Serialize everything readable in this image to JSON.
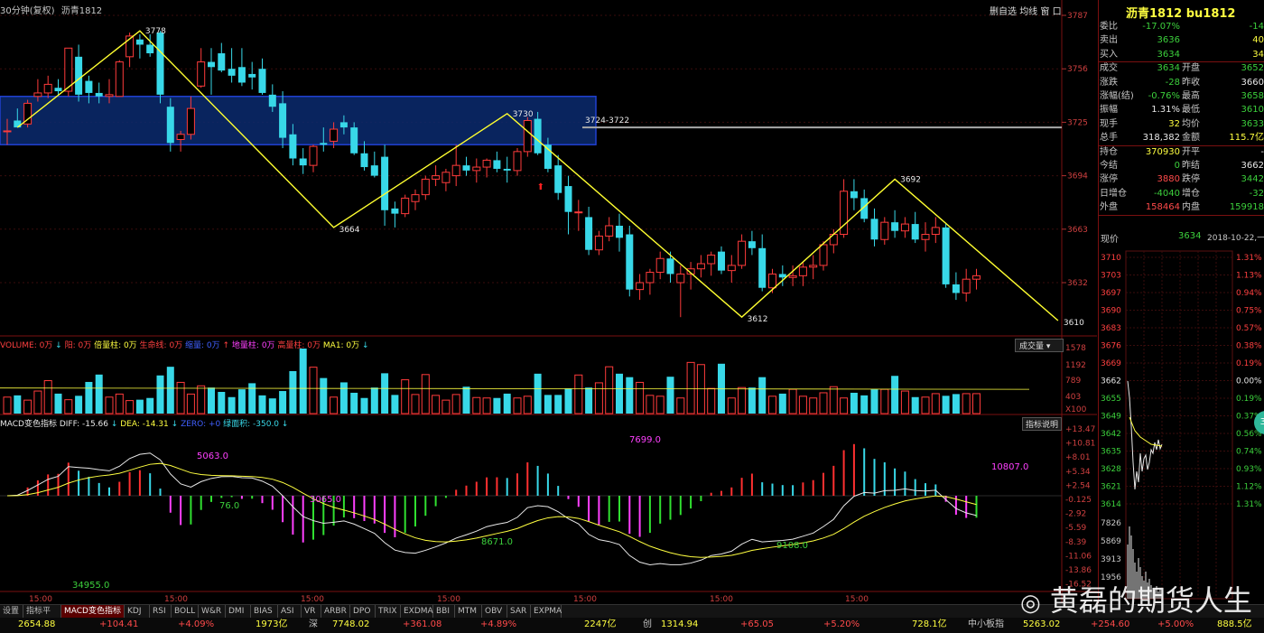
{
  "header": {
    "period": "30分钟(复权)",
    "name": "沥青1812",
    "tools": [
      "删自选",
      "均线",
      "窗",
      "口"
    ]
  },
  "price_axis": {
    "labels": [
      "3787",
      "3756",
      "3725",
      "3694",
      "3663",
      "3632"
    ],
    "values": [
      3787,
      3756,
      3725,
      3694,
      3663,
      3632
    ]
  },
  "annotations": {
    "high1": "3778",
    "low1": "3664",
    "high2": "3730",
    "zone": "3724-3722",
    "low2": "3612",
    "high3": "3692",
    "low3": "3610"
  },
  "volume_panel": {
    "legend": [
      {
        "text": "VOLUME: 0万",
        "color": "#ff4040"
      },
      {
        "text": "↓",
        "color": "#38d8e8"
      },
      {
        "text": "阳: 0万",
        "color": "#ff4040"
      },
      {
        "text": "倍量柱: 0万",
        "color": "#ffff40"
      },
      {
        "text": "生命线: 0万",
        "color": "#ff4040"
      },
      {
        "text": "缩量: 0万",
        "color": "#4060ff"
      },
      {
        "text": "↑",
        "color": "#ff4040"
      },
      {
        "text": "地量柱: 0万",
        "color": "#ff40ff"
      },
      {
        "text": "高量柱: 0万",
        "color": "#ff4040"
      },
      {
        "text": "MA1: 0万",
        "color": "#ffff40"
      },
      {
        "text": "↓",
        "color": "#38d8e8"
      }
    ],
    "dropdown": "成交量",
    "axis": [
      "1578",
      "1192",
      "789",
      "403",
      "X100"
    ]
  },
  "macd_panel": {
    "legend": [
      {
        "text": "MACD变色指标",
        "color": "#e8e8e8"
      },
      {
        "text": "DIFF: -15.66",
        "color": "#e8e8e8"
      },
      {
        "text": "↓",
        "color": "#38d8e8"
      },
      {
        "text": "DEA: -14.31",
        "color": "#ffff40"
      },
      {
        "text": "↓",
        "color": "#38d8e8"
      },
      {
        "text": "ZERO: +0",
        "color": "#4060ff"
      },
      {
        "text": "绿面积: -350.0",
        "color": "#38d8e8"
      },
      {
        "text": "↓",
        "color": "#38d8e8"
      }
    ],
    "help": "指标说明",
    "axis": [
      "+13.47",
      "+10.81",
      "+8.01",
      "+5.34",
      "+2.54",
      "-0.125",
      "-2.92",
      "-5.59",
      "-8.39",
      "-11.06",
      "-13.86",
      "-16.52"
    ],
    "area_labels": [
      {
        "text": "5063.0",
        "color": "#ff40ff"
      },
      {
        "text": "3065.0",
        "color": "#ff40ff"
      },
      {
        "text": "7699.0",
        "color": "#ff40ff"
      },
      {
        "text": "10807.0",
        "color": "#ff40ff"
      },
      {
        "text": "76.0",
        "color": "#3cd03c"
      },
      {
        "text": "8671.0",
        "color": "#3cd03c"
      },
      {
        "text": "9108.0",
        "color": "#3cd03c"
      },
      {
        "text": "34955.0",
        "color": "#3cd03c"
      }
    ]
  },
  "time_axis": [
    "15:00",
    "15:00",
    "15:00",
    "15:00",
    "15:00",
    "15:00",
    "15:00"
  ],
  "quote": {
    "title": "沥青1812 bu1812",
    "rows": [
      {
        "l1": "委比",
        "v1": "-17.07%",
        "c1": "green",
        "l2": "",
        "v2": "-14",
        "c2": "green"
      },
      {
        "l1": "卖出",
        "v1": "3636",
        "c1": "green",
        "l2": "",
        "v2": "40",
        "c2": "yellow"
      },
      {
        "l1": "买入",
        "v1": "3634",
        "c1": "green",
        "l2": "",
        "v2": "34",
        "c2": "yellow"
      },
      {
        "l1": "成交",
        "v1": "3634",
        "c1": "green",
        "l2": "开盘",
        "v2": "3652",
        "c2": "green"
      },
      {
        "l1": "涨跌",
        "v1": "-28",
        "c1": "green",
        "l2": "昨收",
        "v2": "3660",
        "c2": "white"
      },
      {
        "l1": "涨幅(结)",
        "v1": "-0.76%",
        "c1": "green",
        "l2": "最高",
        "v2": "3658",
        "c2": "green"
      },
      {
        "l1": "振幅",
        "v1": "1.31%",
        "c1": "white",
        "l2": "最低",
        "v2": "3610",
        "c2": "green"
      },
      {
        "l1": "现手",
        "v1": "32",
        "c1": "yellow",
        "l2": "均价",
        "v2": "3633",
        "c2": "green"
      },
      {
        "l1": "总手",
        "v1": "318,382",
        "c1": "white",
        "l2": "金额",
        "v2": "115.7亿",
        "c2": "yellow"
      },
      {
        "l1": "持仓",
        "v1": "370930",
        "c1": "yellow",
        "l2": "开平",
        "v2": "-",
        "c2": "white"
      },
      {
        "l1": "今结",
        "v1": "0",
        "c1": "green",
        "l2": "昨结",
        "v2": "3662",
        "c2": "white"
      },
      {
        "l1": "涨停",
        "v1": "3880",
        "c1": "red",
        "l2": "跌停",
        "v2": "3442",
        "c2": "green"
      },
      {
        "l1": "日增仓",
        "v1": "-4040",
        "c1": "green",
        "l2": "增仓",
        "v2": "-32",
        "c2": "green"
      },
      {
        "l1": "外盘",
        "v1": "158464",
        "c1": "red",
        "l2": "内盘",
        "v2": "159918",
        "c2": "green"
      }
    ],
    "now_label": "现价",
    "now_value": "3634",
    "date": "2018-10-22,一",
    "mini_left": [
      "3710",
      "3703",
      "3697",
      "3690",
      "3683",
      "3676",
      "3669",
      "3662",
      "3655",
      "3649",
      "3642",
      "3635",
      "3628",
      "3621",
      "3614",
      "7826",
      "5869",
      "3913",
      "1956"
    ],
    "mini_right": [
      "1.31%",
      "1.13%",
      "0.94%",
      "0.75%",
      "0.57%",
      "0.38%",
      "0.19%",
      "0.00%",
      "0.19%",
      "0.37%",
      "0.56%",
      "0.74%",
      "0.93%",
      "1.12%",
      "1.31%"
    ],
    "badge": "36"
  },
  "tabs": [
    "设置",
    "指标平台",
    "MACD变色指标",
    "KDJ",
    "RSI",
    "BOLL",
    "W&R",
    "DMI",
    "BIAS",
    "ASI",
    "VR",
    "ARBR",
    "DPO",
    "TRIX",
    "EXDMA",
    "BBI",
    "MTM",
    "OBV",
    "SAR",
    "EXPMA"
  ],
  "status": [
    {
      "text": "2654.88",
      "color": "#ffff40"
    },
    {
      "text": "+104.41",
      "color": "#ff4a4a"
    },
    {
      "text": "+4.09%",
      "color": "#ff4a4a"
    },
    {
      "text": "1973亿",
      "color": "#ffff40"
    },
    {
      "text": "深",
      "color": "#c8c8c8"
    },
    {
      "text": "7748.02",
      "color": "#ffff40"
    },
    {
      "text": "+361.08",
      "color": "#ff4a4a"
    },
    {
      "text": "+4.89%",
      "color": "#ff4a4a"
    },
    {
      "text": "2247亿",
      "color": "#ffff40"
    },
    {
      "text": "创",
      "color": "#c8c8c8"
    },
    {
      "text": "1314.94",
      "color": "#ffff40"
    },
    {
      "text": "+65.05",
      "color": "#ff4a4a"
    },
    {
      "text": "+5.20%",
      "color": "#ff4a4a"
    },
    {
      "text": "728.1亿",
      "color": "#ffff40"
    },
    {
      "text": "中小板指",
      "color": "#c8c8c8"
    },
    {
      "text": "5263.02",
      "color": "#ffff40"
    },
    {
      "text": "+254.60",
      "color": "#ff4a4a"
    },
    {
      "text": "+5.00%",
      "color": "#ff4a4a"
    },
    {
      "text": "888.5亿",
      "color": "#ffff40"
    }
  ],
  "watermark": "黄磊的期货人生",
  "chart_data": {
    "type": "candlestick",
    "symbol": "bu1812",
    "candles": [
      [
        3720,
        3727,
        3712,
        3720
      ],
      [
        3726,
        3733,
        3722,
        3722
      ],
      [
        3724,
        3738,
        3722,
        3736
      ],
      [
        3740,
        3750,
        3737,
        3742
      ],
      [
        3742,
        3752,
        3739,
        3747
      ],
      [
        3745,
        3750,
        3741,
        3743
      ],
      [
        3743,
        3768,
        3740,
        3768
      ],
      [
        3763,
        3770,
        3737,
        3741
      ],
      [
        3749,
        3752,
        3736,
        3742
      ],
      [
        3742,
        3748,
        3736,
        3740
      ],
      [
        3740,
        3750,
        3736,
        3741
      ],
      [
        3740,
        3761,
        3740,
        3760
      ],
      [
        3763,
        3777,
        3757,
        3775
      ],
      [
        3773,
        3776,
        3762,
        3770
      ],
      [
        3770,
        3776,
        3763,
        3765
      ],
      [
        3777,
        3778,
        3736,
        3741
      ],
      [
        3734,
        3739,
        3708,
        3713
      ],
      [
        3715,
        3720,
        3708,
        3718
      ],
      [
        3718,
        3740,
        3715,
        3733
      ],
      [
        3746,
        3768,
        3745,
        3760
      ],
      [
        3760,
        3768,
        3741,
        3757
      ],
      [
        3765,
        3771,
        3754,
        3755
      ],
      [
        3756,
        3768,
        3748,
        3752
      ],
      [
        3757,
        3768,
        3746,
        3748
      ],
      [
        3753,
        3760,
        3744,
        3751
      ],
      [
        3756,
        3762,
        3741,
        3742
      ],
      [
        3741,
        3747,
        3731,
        3734
      ],
      [
        3736,
        3743,
        3710,
        3716
      ],
      [
        3718,
        3724,
        3700,
        3704
      ],
      [
        3704,
        3710,
        3695,
        3700
      ],
      [
        3700,
        3712,
        3696,
        3711
      ],
      [
        3713,
        3722,
        3708,
        3712
      ],
      [
        3714,
        3725,
        3710,
        3721
      ],
      [
        3725,
        3729,
        3718,
        3722
      ],
      [
        3722,
        3725,
        3706,
        3707
      ],
      [
        3707,
        3714,
        3697,
        3699
      ],
      [
        3700,
        3708,
        3693,
        3694
      ],
      [
        3705,
        3712,
        3665,
        3674
      ],
      [
        3675,
        3679,
        3664,
        3672
      ],
      [
        3672,
        3683,
        3670,
        3681
      ],
      [
        3679,
        3686,
        3674,
        3683
      ],
      [
        3683,
        3694,
        3680,
        3692
      ],
      [
        3692,
        3700,
        3688,
        3694
      ],
      [
        3690,
        3698,
        3685,
        3696
      ],
      [
        3694,
        3712,
        3688,
        3700
      ],
      [
        3700,
        3705,
        3694,
        3697
      ],
      [
        3697,
        3704,
        3690,
        3699
      ],
      [
        3699,
        3704,
        3693,
        3703
      ],
      [
        3703,
        3708,
        3696,
        3698
      ],
      [
        3698,
        3705,
        3690,
        3697
      ],
      [
        3697,
        3710,
        3694,
        3708
      ],
      [
        3708,
        3728,
        3705,
        3726
      ],
      [
        3727,
        3731,
        3706,
        3707
      ],
      [
        3712,
        3716,
        3696,
        3698
      ],
      [
        3700,
        3706,
        3680,
        3684
      ],
      [
        3688,
        3694,
        3660,
        3673
      ],
      [
        3673,
        3680,
        3662,
        3673
      ],
      [
        3670,
        3676,
        3648,
        3651
      ],
      [
        3651,
        3662,
        3648,
        3659
      ],
      [
        3659,
        3670,
        3656,
        3665
      ],
      [
        3665,
        3672,
        3650,
        3658
      ],
      [
        3660,
        3665,
        3624,
        3628
      ],
      [
        3628,
        3637,
        3622,
        3632
      ],
      [
        3632,
        3640,
        3625,
        3638
      ],
      [
        3638,
        3650,
        3634,
        3646
      ],
      [
        3646,
        3650,
        3632,
        3637
      ],
      [
        3632,
        3642,
        3612,
        3637
      ],
      [
        3637,
        3644,
        3628,
        3640
      ],
      [
        3640,
        3648,
        3635,
        3643
      ],
      [
        3643,
        3650,
        3636,
        3648
      ],
      [
        3650,
        3653,
        3637,
        3639
      ],
      [
        3639,
        3648,
        3632,
        3642
      ],
      [
        3642,
        3660,
        3640,
        3656
      ],
      [
        3656,
        3662,
        3648,
        3652
      ],
      [
        3652,
        3660,
        3627,
        3629
      ],
      [
        3629,
        3640,
        3626,
        3637
      ],
      [
        3637,
        3642,
        3630,
        3635
      ],
      [
        3635,
        3642,
        3630,
        3636
      ],
      [
        3636,
        3644,
        3630,
        3641
      ],
      [
        3641,
        3648,
        3634,
        3642
      ],
      [
        3642,
        3656,
        3639,
        3654
      ],
      [
        3654,
        3663,
        3649,
        3660
      ],
      [
        3660,
        3692,
        3658,
        3685
      ],
      [
        3685,
        3692,
        3674,
        3681
      ],
      [
        3681,
        3686,
        3667,
        3669
      ],
      [
        3669,
        3675,
        3653,
        3657
      ],
      [
        3657,
        3670,
        3654,
        3667
      ],
      [
        3667,
        3674,
        3658,
        3662
      ],
      [
        3662,
        3670,
        3658,
        3666
      ],
      [
        3666,
        3673,
        3655,
        3657
      ],
      [
        3657,
        3667,
        3650,
        3660
      ],
      [
        3660,
        3670,
        3655,
        3664
      ],
      [
        3664,
        3666,
        3629,
        3631
      ],
      [
        3631,
        3638,
        3622,
        3626
      ],
      [
        3626,
        3640,
        3621,
        3634
      ],
      [
        3634,
        3640,
        3628,
        3636
      ]
    ],
    "zigzag": [
      {
        "i": 1,
        "price": 3722
      },
      {
        "i": 13,
        "price": 3778
      },
      {
        "i": 32,
        "price": 3664
      },
      {
        "i": 49,
        "price": 3730
      },
      {
        "i": 72,
        "price": 3612
      },
      {
        "i": 87,
        "price": 3692
      },
      {
        "i": 103,
        "price": 3610
      }
    ],
    "zone": {
      "from": 3712,
      "to": 3740
    },
    "level": 3722,
    "volume_hundreds": [
      380,
      420,
      310,
      520,
      760,
      460,
      320,
      410,
      730,
      900,
      380,
      450,
      300,
      320,
      360,
      880,
      1080,
      720,
      450,
      640,
      600,
      500,
      380,
      560,
      700,
      420,
      350,
      520,
      980,
      1512,
      1070,
      820,
      380,
      720,
      480,
      360,
      600,
      930,
      430,
      780,
      440,
      900,
      420,
      310,
      440,
      620,
      370,
      360,
      360,
      460,
      360,
      400,
      920,
      430,
      430,
      580,
      890,
      600,
      710,
      1080,
      920,
      840,
      720,
      420,
      400,
      850,
      360,
      1180,
      1130,
      580,
      1150,
      360,
      600,
      600,
      840,
      400,
      460,
      560,
      400,
      360,
      480,
      620,
      360,
      480,
      420,
      560,
      560,
      870,
      520,
      380,
      380,
      460,
      410,
      450,
      460,
      460,
      380,
      1500,
      1000,
      430,
      380,
      400,
      430,
      400
    ],
    "volume_ma": [
      590,
      560
    ]
  }
}
